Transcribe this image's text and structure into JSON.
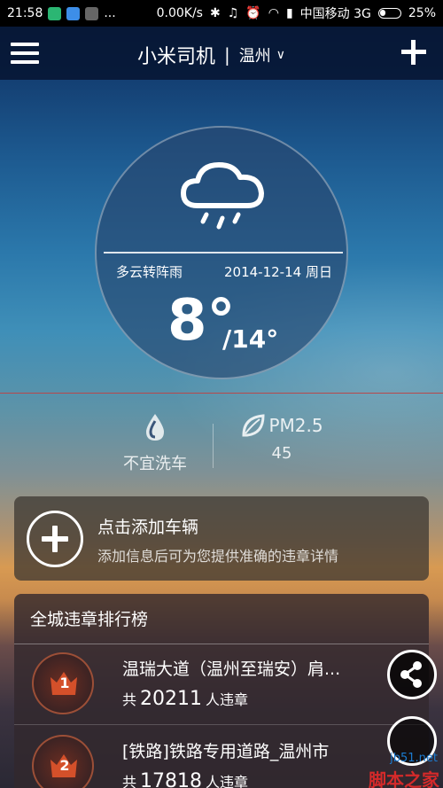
{
  "status_bar": {
    "time": "21:58",
    "dots": "...",
    "speed": "0.00K/s",
    "carrier": "中国移动 3G",
    "battery": "25%"
  },
  "topbar": {
    "title": "小米司机",
    "separator": "|",
    "city": "温州",
    "chevron": "∨"
  },
  "weather": {
    "icon": "cloud-rain-icon",
    "condition": "多云转阵雨",
    "date": "2014-12-14 周日",
    "low": "8°",
    "high": "/14°"
  },
  "indicators": {
    "car_wash": "不宜洗车",
    "pm_label": "PM2.5",
    "pm_value": "45"
  },
  "add_vehicle": {
    "title": "点击添加车辆",
    "subtitle": "添加信息后可为您提供准确的违章详情"
  },
  "ranking": {
    "title": "全城违章排行榜",
    "items": [
      {
        "rank": "1",
        "road": "温瑞大道（温州至瑞安）肩...",
        "prefix": "共",
        "count": "20211",
        "suffix": "人违章"
      },
      {
        "rank": "2",
        "road": "[铁路]铁路专用道路_温州市",
        "prefix": "共",
        "count": "17818",
        "suffix": "人违章"
      }
    ]
  },
  "watermark": {
    "url": "jb51.net",
    "text": "脚本之家"
  },
  "colors": {
    "accent_red": "#b8484a",
    "badge": "#c8542f",
    "watermark_red": "#d42a2a"
  }
}
